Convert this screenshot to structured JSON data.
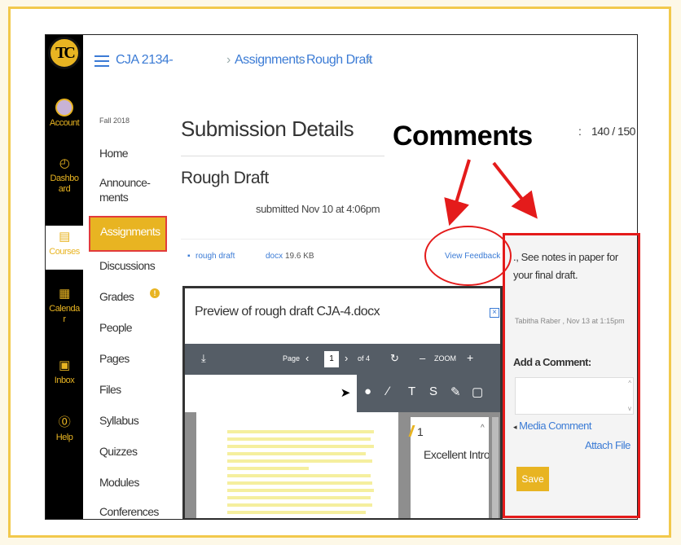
{
  "brand": {
    "logo_text": "TC",
    "accent": "#e8b422",
    "link": "#3b7bd5",
    "annotation_red": "#e41b1b"
  },
  "global_nav": {
    "account": "Account",
    "dashboard_1": "Dashbo",
    "dashboard_2": "ard",
    "courses": "Courses",
    "calendar_1": "Calenda",
    "calendar_2": "r",
    "inbox": "Inbox",
    "help": "Help"
  },
  "header": {
    "course": "CJA 2134-",
    "crumb_assignments": "Assignments",
    "crumb_rough_draft": "Rough Draft",
    "sep": "›"
  },
  "course_nav": {
    "term": "Fall 2018",
    "items": [
      "Home",
      "Announce-",
      "ments",
      "Assignments",
      "Discussions",
      "Grades",
      "People",
      "Pages",
      "Files",
      "Syllabus",
      "Quizzes",
      "Modules",
      "Conferences"
    ]
  },
  "main": {
    "title": "Submission Details",
    "score_colon": ":",
    "score": "140 / 150",
    "assignment": "Rough Draft",
    "submitted": "submitted Nov 10 at 4:06pm",
    "file_name": "rough draft",
    "file_ext": "docx",
    "file_size": "19.6 KB",
    "view_feedback": "View Feedback"
  },
  "preview": {
    "title": "Preview of rough draft CJA-4.docx",
    "close": "×",
    "page_label": "Page",
    "page_num": "1",
    "page_of": "of 4",
    "zoom": "ZOOM",
    "minus": "–",
    "plus": "+",
    "annotation_num": "1",
    "annotation_text": "Excellent Intro"
  },
  "comments": {
    "comment_text": "., See notes in paper for your final draft.",
    "comment_meta": "Tabitha Raber , Nov 13 at 1:15pm",
    "add_label": "Add a Comment:",
    "media": "Media Comment",
    "attach": "Attach File",
    "save": "Save"
  },
  "annotation": {
    "label": "Comments"
  }
}
